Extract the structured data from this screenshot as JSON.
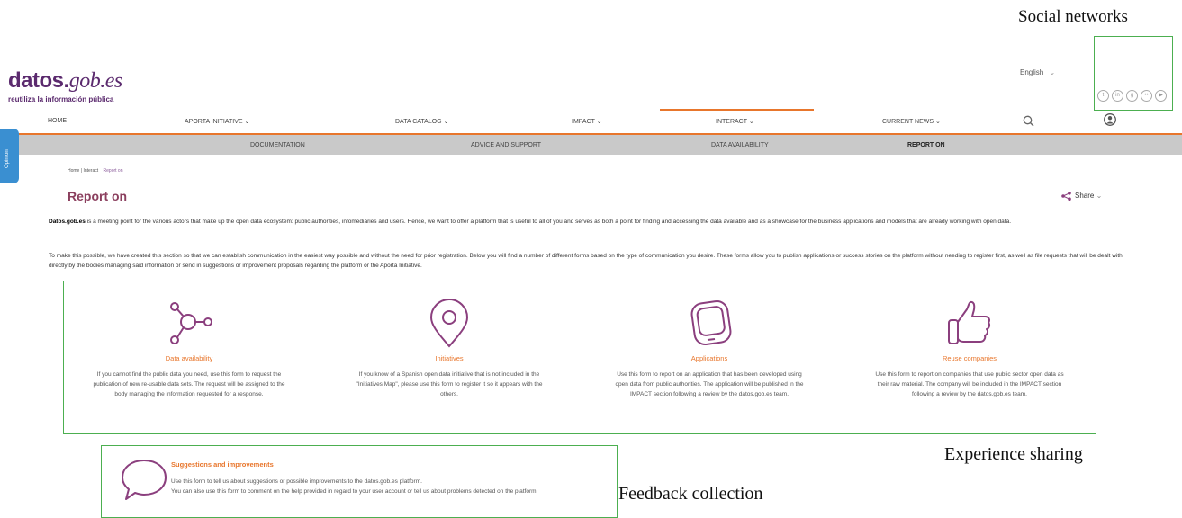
{
  "annotations": {
    "social_networks": "Social networks",
    "experience_sharing": "Experience sharing",
    "feedback_collection": "Feedback collection"
  },
  "logo": {
    "brand_bold": "datos.",
    "brand_italic": "gob.es",
    "tagline": "reutiliza la información pública"
  },
  "header": {
    "language": "English",
    "social_icons": [
      "twitter-icon",
      "linkedin-icon",
      "github-icon",
      "flickr-icon",
      "youtube-icon"
    ]
  },
  "nav": {
    "items": [
      {
        "label": "HOME"
      },
      {
        "label": "APORTA INITIATIVE"
      },
      {
        "label": "DATA CATALOG"
      },
      {
        "label": "IMPACT"
      },
      {
        "label": "INTERACT"
      },
      {
        "label": "CURRENT NEWS"
      }
    ]
  },
  "subnav": {
    "items": [
      {
        "label": "DOCUMENTATION"
      },
      {
        "label": "ADVICE AND SUPPORT"
      },
      {
        "label": "DATA AVAILABILITY"
      },
      {
        "label": "REPORT ON"
      }
    ],
    "active_index": 3
  },
  "side_tab": {
    "label": "Opinion"
  },
  "breadcrumb": {
    "home": "Home",
    "sep1": "|",
    "section": "Interact",
    "current": "Report on"
  },
  "page": {
    "title": "Report on",
    "share_label": "Share",
    "intro_bold": "Datos.gob.es",
    "intro_rest": " is a meeting point for the various actors that make up the open data ecosystem: public authorities, infomediaries and users. Hence, we want to offer a platform that is useful to all of you and serves as both a point for finding and accessing the data available and as a showcase for the business applications and models that are already working with open data.",
    "para2": "To make this possible, we have created this section so that we can establish communication in the easiest way possible and without the need for prior registration. Below you will find a number of different forms based on the type of communication you desire. These forms allow you to publish applications or success stories on the platform without needing to register first, as well as file requests that will be dealt with directly by the bodies managing said information or send in suggestions or improvement proposals regarding the platform or the Aporta Initiative."
  },
  "cards": [
    {
      "title": "Data availability",
      "icon": "network-icon",
      "text": "If you cannot find the public data you need, use this form to request the publication of new re-usable data sets. The request will be assigned to the body managing the information requested for a response."
    },
    {
      "title": "Initiatives",
      "icon": "map-pin-icon",
      "text": "If you know of a Spanish open data initiative that is not included in the \"Initiatives Map\", please use this form to register it so it appears with the others."
    },
    {
      "title": "Applications",
      "icon": "device-icon",
      "text": "Use this form to report on an application that has been developed using open data from public authorities. The application will be published in the IMPACT section following a review by the datos.gob.es team."
    },
    {
      "title": "Reuse companies",
      "icon": "thumbs-up-icon",
      "text": "Use this form to report on companies that use public sector open data as their raw material. The company will be included in the IMPACT section following a review by the datos.gob.es team."
    }
  ],
  "suggestions": {
    "title": "Suggestions and improvements",
    "icon": "speech-bubble-icon",
    "line1": "Use this form to tell us about suggestions or possible improvements to the datos.gob.es platform.",
    "line2": "You can also use this form to comment on the help provided in regard to your user account or tell us about problems detected on the platform."
  },
  "colors": {
    "accent": "#e8762c",
    "brand": "#5b2a6e",
    "icon": "#8b3f7e",
    "annotation_box": "#4caf50",
    "feedback_tab": "#3a8fd1"
  }
}
